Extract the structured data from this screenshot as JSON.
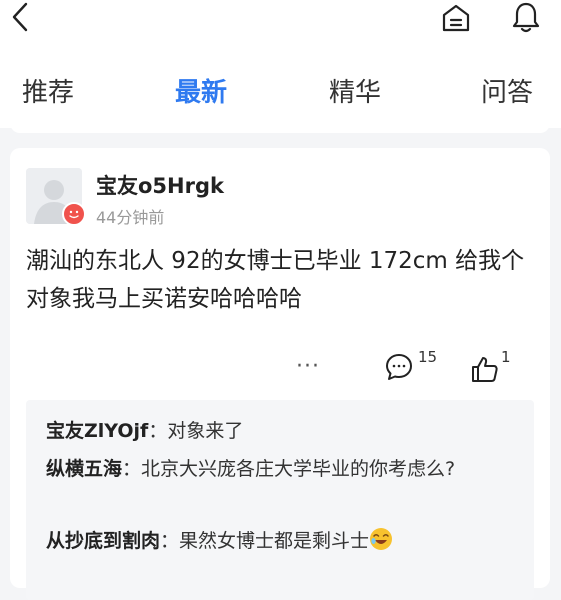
{
  "header": {
    "back_icon": "chevron-left-icon",
    "home_icon": "home-icon",
    "bell_icon": "bell-icon"
  },
  "tabs": [
    {
      "label": "推荐",
      "active": false
    },
    {
      "label": "最新",
      "active": true
    },
    {
      "label": "精华",
      "active": false
    },
    {
      "label": "问答",
      "active": false
    }
  ],
  "post": {
    "username": "宝友o5Hrgk",
    "timestamp": "44分钟前",
    "body": "潮汕的东北人 92的女博士已毕业 172cm 给我个对象我马上买诺安哈哈哈哈",
    "more_label": "···",
    "comment_count": "15",
    "like_count": "1",
    "accent_color": "#2f7af0",
    "badge_color": "#f0524c"
  },
  "comments": [
    {
      "author": "宝友ZlYOjf",
      "sep": "：",
      "text": "对象来了"
    },
    {
      "author": "纵横五海",
      "sep": "：",
      "text": "北京大兴庞各庄大学毕业的你考虑么?"
    },
    {
      "author": "从抄底到割肉",
      "sep": "：",
      "text": "果然女博士都是剩斗士"
    }
  ]
}
